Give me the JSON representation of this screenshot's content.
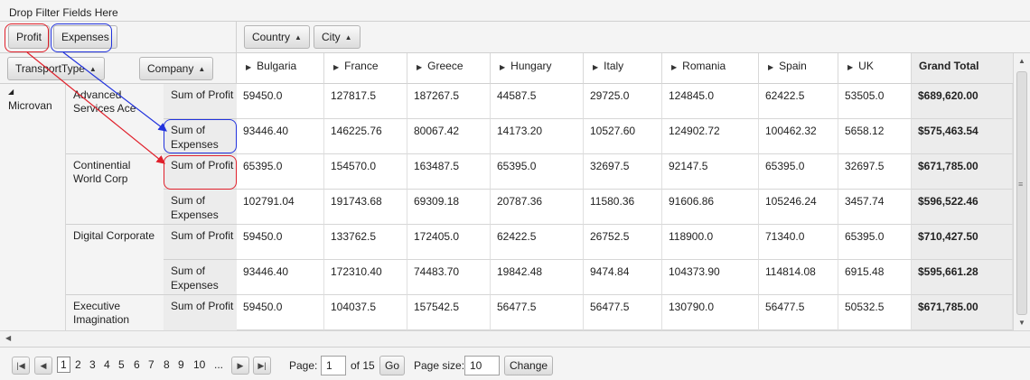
{
  "filter_zone": {
    "label": "Drop Filter Fields Here"
  },
  "data_fields": [
    "Profit",
    "Expenses"
  ],
  "column_fields": [
    "Country",
    "City"
  ],
  "row_fields": [
    "TransportType",
    "Company"
  ],
  "countries": [
    "Bulgaria",
    "France",
    "Greece",
    "Hungary",
    "Italy",
    "Romania",
    "Spain",
    "UK"
  ],
  "grand_total_label": "Grand Total",
  "rows": {
    "transport": "Microvan",
    "companies": [
      "Advanced Services Ace",
      "Continential World Corp",
      "Digital Corporate",
      "Executive Imagination"
    ],
    "measures": [
      "Sum of Profit",
      "Sum of Expenses"
    ],
    "data": [
      {
        "values": [
          "59450.0",
          "127817.5",
          "187267.5",
          "44587.5",
          "29725.0",
          "124845.0",
          "62422.5",
          "53505.0"
        ],
        "total": "$689,620.00"
      },
      {
        "values": [
          "93446.40",
          "146225.76",
          "80067.42",
          "14173.20",
          "10527.60",
          "124902.72",
          "100462.32",
          "5658.12"
        ],
        "total": "$575,463.54"
      },
      {
        "values": [
          "65395.0",
          "154570.0",
          "163487.5",
          "65395.0",
          "32697.5",
          "92147.5",
          "65395.0",
          "32697.5"
        ],
        "total": "$671,785.00"
      },
      {
        "values": [
          "102791.04",
          "191743.68",
          "69309.18",
          "20787.36",
          "11580.36",
          "91606.86",
          "105246.24",
          "3457.74"
        ],
        "total": "$596,522.46"
      },
      {
        "values": [
          "59450.0",
          "133762.5",
          "172405.0",
          "62422.5",
          "26752.5",
          "118900.0",
          "71340.0",
          "65395.0"
        ],
        "total": "$710,427.50"
      },
      {
        "values": [
          "93446.40",
          "172310.40",
          "74483.70",
          "19842.48",
          "9474.84",
          "104373.90",
          "114814.08",
          "6915.48"
        ],
        "total": "$595,661.28"
      },
      {
        "values": [
          "59450.0",
          "104037.5",
          "157542.5",
          "56477.5",
          "56477.5",
          "130790.0",
          "56477.5",
          "50532.5"
        ],
        "total": "$671,785.00"
      }
    ]
  },
  "pager": {
    "pages": [
      "1",
      "2",
      "3",
      "4",
      "5",
      "6",
      "7",
      "8",
      "9",
      "10",
      "..."
    ],
    "page_label": "Page:",
    "page_value": "1",
    "of_label": "of 15",
    "go_label": "Go",
    "size_label": "Page size:",
    "size_value": "10",
    "change_label": "Change"
  },
  "colors": {
    "highlight_red": "#e0202b",
    "highlight_blue": "#2233dd",
    "grand_total_bg": "#ececec"
  }
}
